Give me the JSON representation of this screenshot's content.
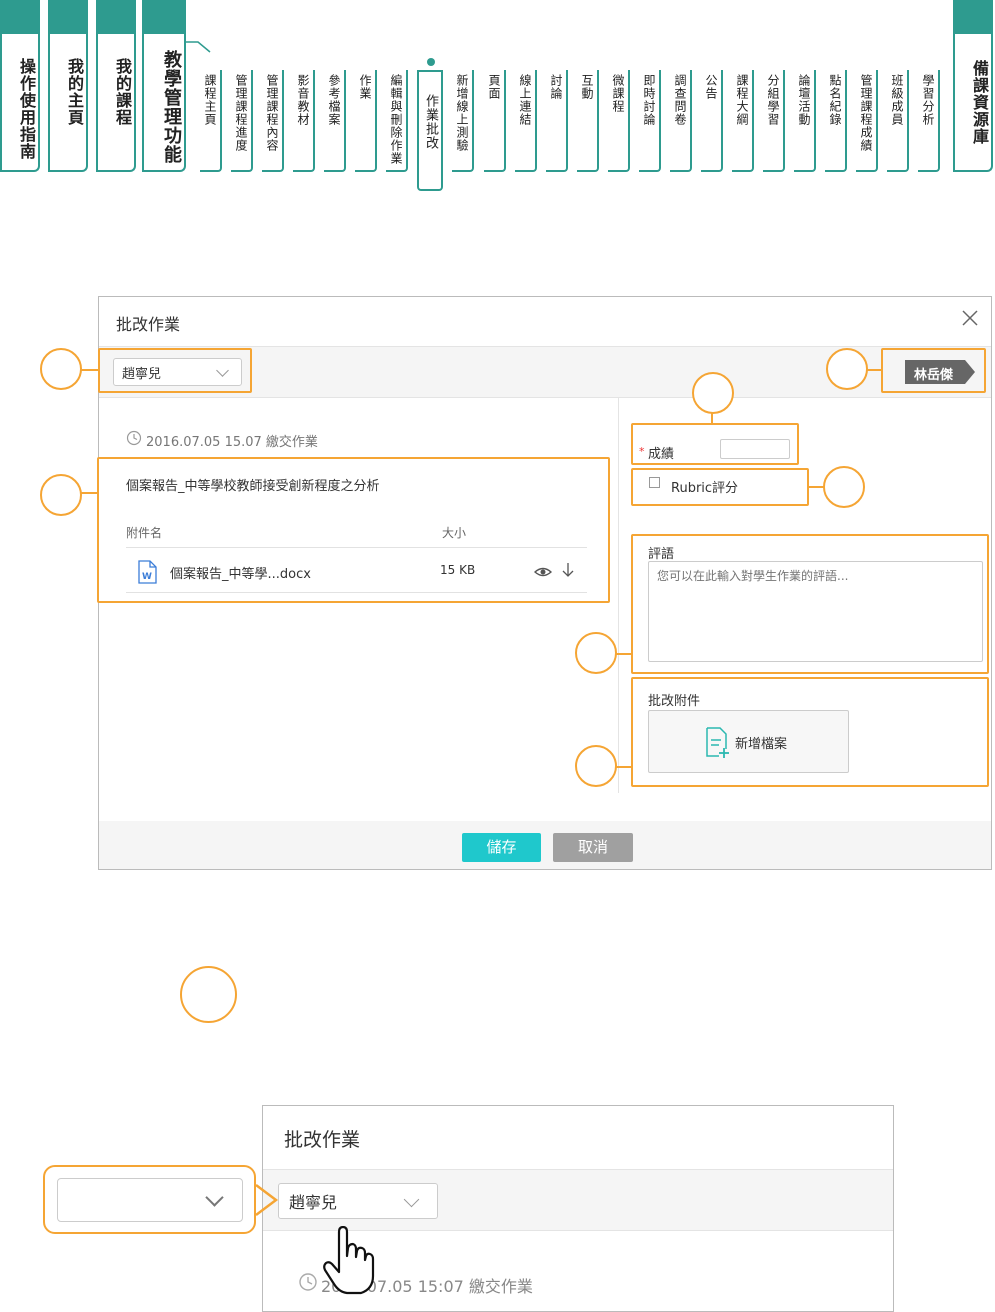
{
  "nav": {
    "main_tabs": [
      "操作使用指南",
      "我的主頁",
      "我的課程",
      "教學管理功能"
    ],
    "sub_tabs": [
      "課程主頁",
      "管理課程進度",
      "管理課程內容",
      "影音教材",
      "參考檔案",
      "作業",
      "編輯與刪除作業",
      "作業批改",
      "新增線上測驗",
      "頁面",
      "線上連結",
      "討論",
      "互動",
      "微課程",
      "即時討論",
      "調查問卷",
      "公告",
      "課程大綱",
      "分組學習",
      "論壇活動",
      "點名紀錄",
      "管理課程成績",
      "班級成員",
      "學習分析"
    ],
    "active_sub_tab": "作業批改",
    "right_tab": "備課資源庫"
  },
  "dialog": {
    "title": "批改作業",
    "student_select": "趙寧兒",
    "next_student": "林岳傑",
    "submit_time": "2016.07.05 15.07 繳交作業",
    "assignment_title": "個案報告_中等學校教師接受創新程度之分析",
    "attach_header_name": "附件名",
    "attach_header_size": "大小",
    "file_name": "個案報告_中等學...docx",
    "file_size": "15 KB",
    "score_label": "成績",
    "required_mark": "*",
    "rubric_label": "Rubric評分",
    "comment_label": "評語",
    "comment_placeholder": "您可以在此輸入對學生作業的評語...",
    "attach_label": "批改附件",
    "add_file_label": "新增檔案",
    "save_label": "儲存",
    "cancel_label": "取消"
  },
  "zoom": {
    "title": "批改作業",
    "student_select": "趙寧兒",
    "submit_time": "2016.07.05 15:07 繳交作業"
  },
  "colors": {
    "teal": "#2e9b8f",
    "orange": "#f5a534",
    "save": "#1fc8cc",
    "cancel": "#a0a0a0"
  }
}
